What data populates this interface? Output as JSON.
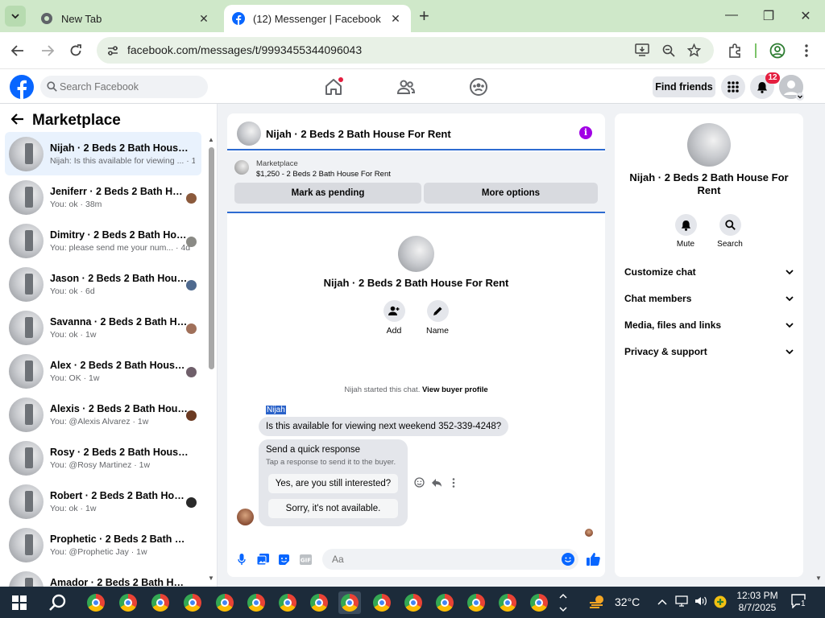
{
  "browser": {
    "tabs": [
      {
        "title": "New Tab"
      },
      {
        "title": "(12) Messenger | Facebook"
      }
    ],
    "url": "facebook.com/messages/t/9993455344096043"
  },
  "fb": {
    "search_placeholder": "Search Facebook",
    "find_friends": "Find friends",
    "notif_count": "12"
  },
  "sidebar": {
    "title": "Marketplace",
    "conversations": [
      {
        "name": "Nijah · 2 Beds 2 Bath House For Rent",
        "preview": "Nijah: Is this available for viewing ... · 1m"
      },
      {
        "name": "Jeniferr · 2 Beds 2 Bath House For Rent",
        "preview": "You: ok · 38m"
      },
      {
        "name": "Dimitry · 2 Beds 2 Bath House For Rent",
        "preview": "You: please send me your num... · 4d"
      },
      {
        "name": "Jason · 2 Beds 2 Bath House For Rent",
        "preview": "You: ok · 6d"
      },
      {
        "name": "Savanna · 2 Beds 2 Bath House For Rent",
        "preview": "You: ok · 1w"
      },
      {
        "name": "Alex · 2 Beds 2 Bath House For Rent",
        "preview": "You: OK · 1w"
      },
      {
        "name": "Alexis · 2 Beds 2 Bath House For Rent",
        "preview": "You: @Alexis Alvarez · 1w"
      },
      {
        "name": "Rosy · 2 Beds 2 Bath House For Rent",
        "preview": "You: @Rosy Martinez · 1w"
      },
      {
        "name": "Robert · 2 Beds 2 Bath House For Rent",
        "preview": "You: ok · 1w"
      },
      {
        "name": "Prophetic · 2 Beds 2 Bath House For Rent",
        "preview": "You: @Prophetic Jay · 1w"
      },
      {
        "name": "Amador · 2 Beds 2 Bath House For Rent",
        "preview": ""
      }
    ]
  },
  "chat": {
    "title": "Nijah · 2 Beds 2 Bath House For Rent",
    "marketplace_label": "Marketplace",
    "listing": "$1,250 - 2 Beds 2 Bath House For Rent",
    "mark_pending": "Mark as pending",
    "more_options": "More options",
    "intro_name": "Nijah · 2 Beds 2 Bath House For Rent",
    "add_label": "Add",
    "name_label": "Name",
    "system_text": "Nijah started this chat.",
    "view_buyer": "View buyer profile",
    "sender": "Nijah",
    "message": "Is this available for viewing next weekend 352-339-4248?",
    "quick_title": "Send a quick response",
    "quick_sub": "Tap a response to send it to the buyer.",
    "quick_1": "Yes, are you still interested?",
    "quick_2": "Sorry, it's not available.",
    "composer_placeholder": "Aa"
  },
  "panel": {
    "name": "Nijah · 2 Beds 2 Bath House For Rent",
    "mute": "Mute",
    "search": "Search",
    "rows": [
      "Customize chat",
      "Chat members",
      "Media, files and links",
      "Privacy & support"
    ]
  },
  "taskbar": {
    "temperature": "32°C",
    "time": "12:03 PM",
    "date": "8/7/2025",
    "notif_count": "1"
  },
  "colors": {
    "fb_blue": "#0866ff",
    "tab_bar": "#cfe8c9",
    "taskbar": "#1c2b3a",
    "selected_conv": "#e9f2fd"
  }
}
